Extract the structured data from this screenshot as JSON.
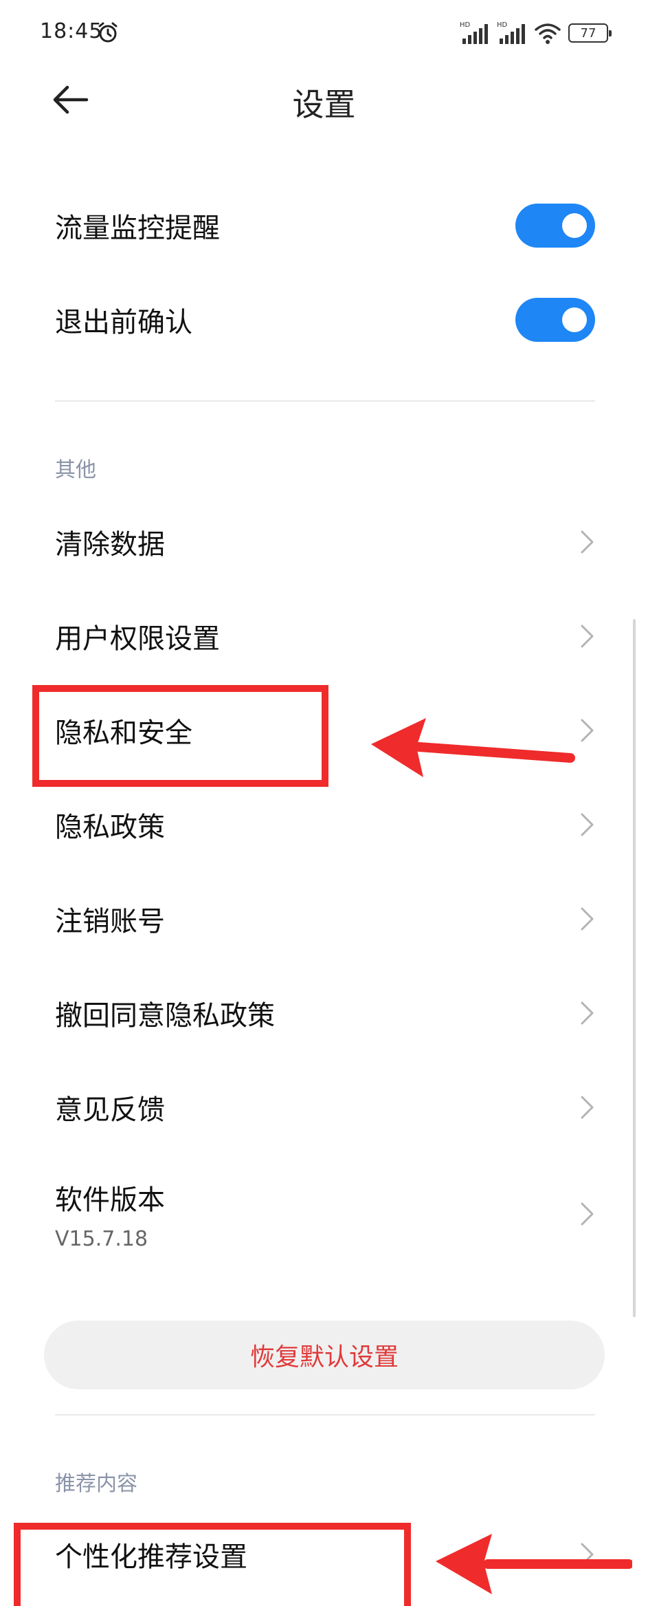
{
  "status_bar": {
    "time": "18:45",
    "alarm_icon": "alarm-clock-icon",
    "network_labels": [
      "HD",
      "HD"
    ],
    "battery_level": "77"
  },
  "header": {
    "back_icon": "arrow-left-icon",
    "title": "设置"
  },
  "toggles": [
    {
      "label": "流量监控提醒",
      "on": true
    },
    {
      "label": "退出前确认",
      "on": true
    }
  ],
  "section_other": {
    "label": "其他",
    "items": [
      {
        "label": "清除数据"
      },
      {
        "label": "用户权限设置"
      },
      {
        "label": "隐私和安全"
      },
      {
        "label": "隐私政策"
      },
      {
        "label": "注销账号"
      },
      {
        "label": "撤回同意隐私政策"
      },
      {
        "label": "意见反馈"
      },
      {
        "label": "软件版本",
        "sub": "V15.7.18"
      }
    ]
  },
  "restore_button": "恢复默认设置",
  "section_recommend": {
    "label": "推荐内容",
    "items": [
      {
        "label": "个性化推荐设置"
      }
    ]
  },
  "colors": {
    "toggle_on": "#1e86f5",
    "restore_text": "#e03a3a",
    "annotation_red": "#ef2b2b",
    "section_label": "#8a93a8"
  }
}
